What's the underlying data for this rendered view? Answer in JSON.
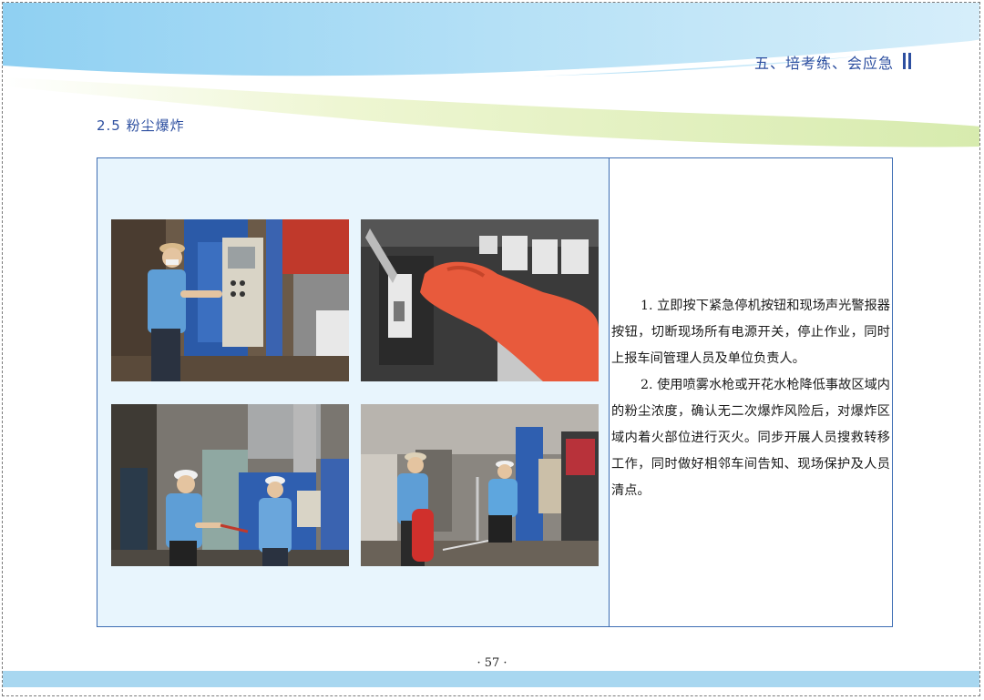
{
  "header": {
    "title": "五、培考练、会应急"
  },
  "section": {
    "title": "2.5 粉尘爆炸"
  },
  "steps": [
    "1. 立即按下紧急停机按钮和现场声光警报器按钮，切断现场所有电源开关，停止作业，同时上报车间管理人员及单位负责人。",
    "2. 使用喷雾水枪或开花水枪降低事故区域内的粉尘浓度，确认无二次爆炸风险后，对爆炸区域内着火部位进行灭火。同步开展人员搜救转移工作，同时做好相邻车间告知、现场保护及人员清点。"
  ],
  "footer": {
    "page_number": "· 57 ·"
  },
  "colors": {
    "accent": "#2d4fa0",
    "border": "#3d6db3",
    "pane": "#e8f5fd",
    "band": "#a8d7f0"
  }
}
